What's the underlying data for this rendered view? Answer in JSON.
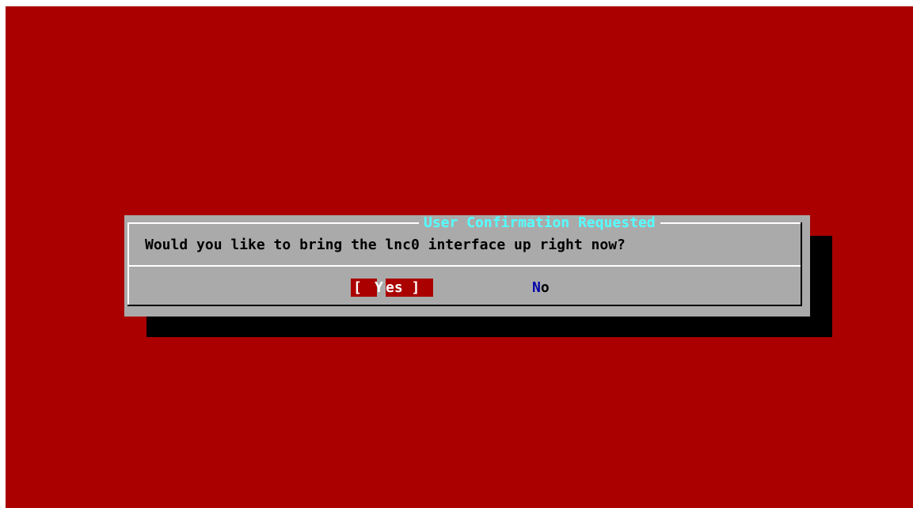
{
  "dialog": {
    "title": "User Confirmation Requested",
    "message": "Would you like to bring the lnc0 interface up right now?",
    "buttons": {
      "yes": {
        "open_bracket": "[ ",
        "hotkey": "Y",
        "rest": "es ]"
      },
      "no": {
        "hotkey": "N",
        "rest": "o"
      }
    }
  },
  "colors": {
    "background": "#aa0000",
    "dialog": "#aaaaaa",
    "title_text": "#55ffff",
    "selected_button": "#aa0000",
    "hotkey": "#0000aa",
    "shadow": "#000000"
  }
}
